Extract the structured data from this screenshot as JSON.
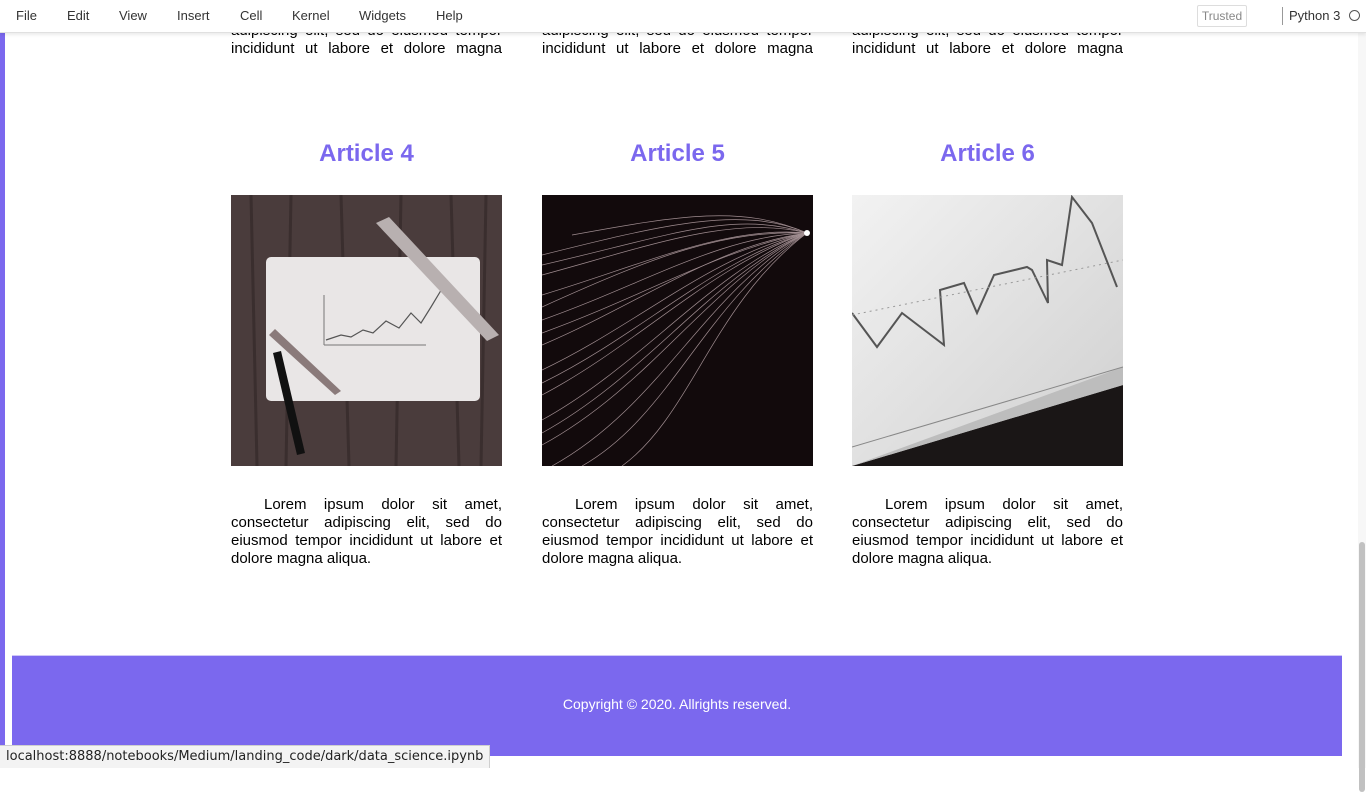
{
  "menubar": {
    "items": [
      "File",
      "Edit",
      "View",
      "Insert",
      "Cell",
      "Kernel",
      "Widgets",
      "Help"
    ],
    "trusted_label": "Trusted",
    "kernel_name": "Python 3"
  },
  "articles_top": {
    "text": "Lorem ipsum dolor sit amet, consectetur adipiscing elit, sed do eiusmod tempor incididunt ut labore et dolore magna aliqua."
  },
  "articles": [
    {
      "title": "Article 4",
      "image": "paper-chart-ruler-pen-photo",
      "text": "Lorem ipsum dolor sit amet, consectetur adipiscing elit, sed do eiusmod tempor incididunt ut labore et dolore magna aliqua."
    },
    {
      "title": "Article 5",
      "image": "light-trails-dark-photo",
      "text": "Lorem ipsum dolor sit amet, consectetur adipiscing elit, sed do eiusmod tempor incididunt ut labore et dolore magna aliqua."
    },
    {
      "title": "Article 6",
      "image": "line-graph-screen-photo",
      "text": "Lorem ipsum dolor sit amet, consectetur adipiscing elit, sed do eiusmod tempor incididunt ut labore et dolore magna aliqua."
    }
  ],
  "footer": {
    "copyright": "Copyright © 2020. Allrights reserved."
  },
  "status_bar": {
    "url": "localhost:8888/notebooks/Medium/landing_code/dark/data_science.ipynb"
  },
  "colors": {
    "accent": "#7b68ee",
    "footer_bg": "#7b68ee"
  }
}
